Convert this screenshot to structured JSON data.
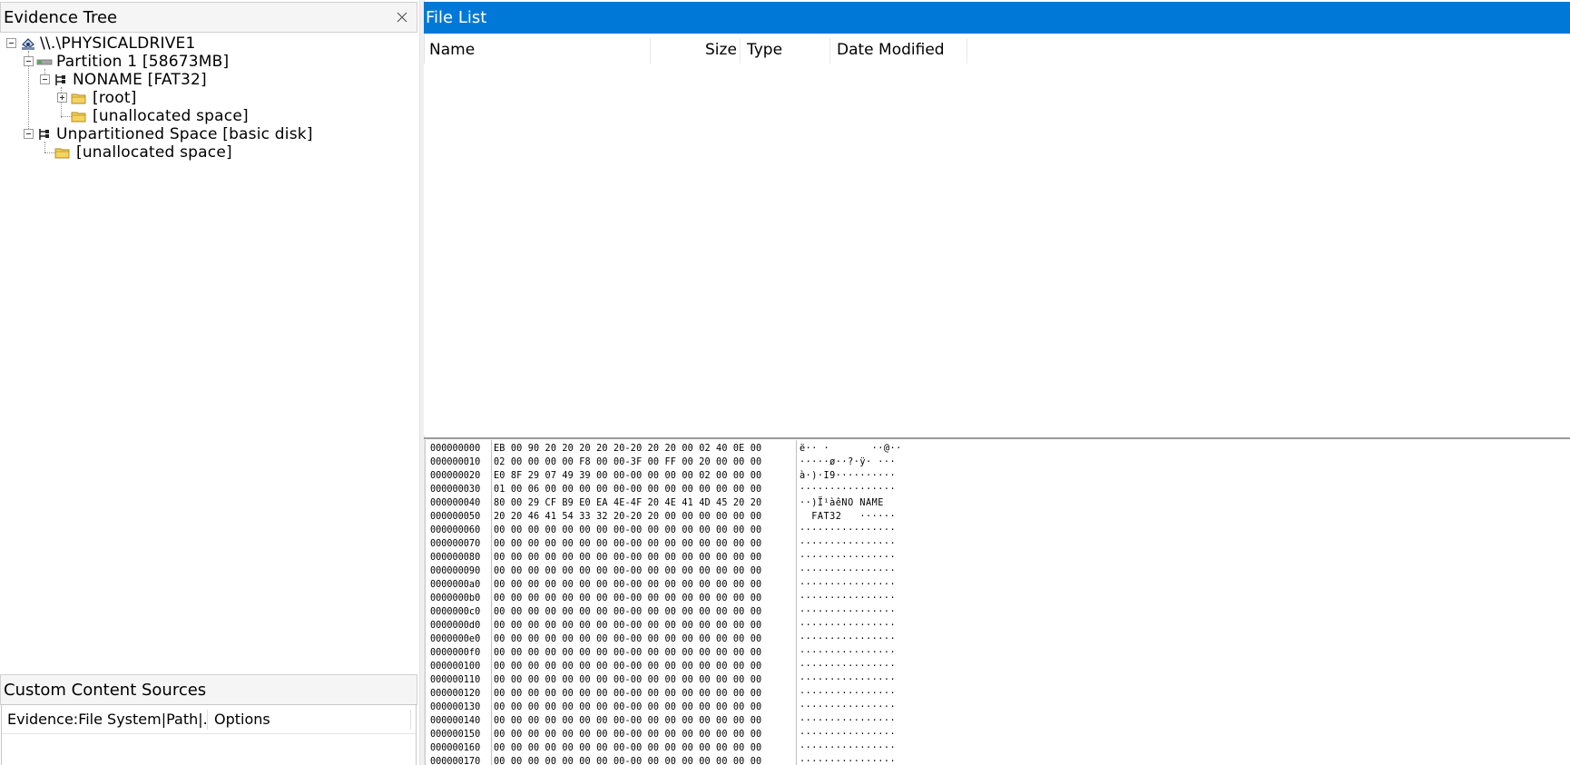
{
  "evidence_tree": {
    "title": "Evidence Tree",
    "nodes": [
      {
        "label": "\\\\.\\PHYSICALDRIVE1",
        "icon": "drive-icon"
      },
      {
        "label": "Partition 1 [58673MB]",
        "icon": "partition-icon"
      },
      {
        "label": "NONAME [FAT32]",
        "icon": "filesystem-icon"
      },
      {
        "label": "[root]",
        "icon": "folder-icon"
      },
      {
        "label": "[unallocated space]",
        "icon": "folder-icon"
      },
      {
        "label": "Unpartitioned Space [basic disk]",
        "icon": "filesystem-icon"
      },
      {
        "label": "[unallocated space]",
        "icon": "folder-icon"
      }
    ]
  },
  "custom_content": {
    "title": "Custom Content Sources",
    "columns": [
      "Evidence:File System|Path|...",
      "Options"
    ]
  },
  "file_list": {
    "title": "File List",
    "columns": [
      "Name",
      "Size",
      "Type",
      "Date Modified"
    ],
    "accent": "#0078d7"
  },
  "hex_view": {
    "rows": [
      {
        "offset": "000000000",
        "bytes": "EB 00 90 20 20 20 20 20-20 20 20 00 02 40 0E 00",
        "ascii": "ë·· ·       ··@··"
      },
      {
        "offset": "000000010",
        "bytes": "02 00 00 00 00 F8 00 00-3F 00 FF 00 20 00 00 00",
        "ascii": "·····ø··?·ÿ· ···"
      },
      {
        "offset": "000000020",
        "bytes": "E0 8F 29 07 49 39 00 00-00 00 00 00 02 00 00 00",
        "ascii": "à·)·I9··········"
      },
      {
        "offset": "000000030",
        "bytes": "01 00 06 00 00 00 00 00-00 00 00 00 00 00 00 00",
        "ascii": "················"
      },
      {
        "offset": "000000040",
        "bytes": "80 00 29 CF B9 E0 EA 4E-4F 20 4E 41 4D 45 20 20",
        "ascii": "··)Ï¹àêNO NAME  "
      },
      {
        "offset": "000000050",
        "bytes": "20 20 46 41 54 33 32 20-20 20 00 00 00 00 00 00",
        "ascii": "  FAT32   ······"
      },
      {
        "offset": "000000060",
        "bytes": "00 00 00 00 00 00 00 00-00 00 00 00 00 00 00 00",
        "ascii": "················"
      },
      {
        "offset": "000000070",
        "bytes": "00 00 00 00 00 00 00 00-00 00 00 00 00 00 00 00",
        "ascii": "················"
      },
      {
        "offset": "000000080",
        "bytes": "00 00 00 00 00 00 00 00-00 00 00 00 00 00 00 00",
        "ascii": "················"
      },
      {
        "offset": "000000090",
        "bytes": "00 00 00 00 00 00 00 00-00 00 00 00 00 00 00 00",
        "ascii": "················"
      },
      {
        "offset": "0000000a0",
        "bytes": "00 00 00 00 00 00 00 00-00 00 00 00 00 00 00 00",
        "ascii": "················"
      },
      {
        "offset": "0000000b0",
        "bytes": "00 00 00 00 00 00 00 00-00 00 00 00 00 00 00 00",
        "ascii": "················"
      },
      {
        "offset": "0000000c0",
        "bytes": "00 00 00 00 00 00 00 00-00 00 00 00 00 00 00 00",
        "ascii": "················"
      },
      {
        "offset": "0000000d0",
        "bytes": "00 00 00 00 00 00 00 00-00 00 00 00 00 00 00 00",
        "ascii": "················"
      },
      {
        "offset": "0000000e0",
        "bytes": "00 00 00 00 00 00 00 00-00 00 00 00 00 00 00 00",
        "ascii": "················"
      },
      {
        "offset": "0000000f0",
        "bytes": "00 00 00 00 00 00 00 00-00 00 00 00 00 00 00 00",
        "ascii": "················"
      },
      {
        "offset": "000000100",
        "bytes": "00 00 00 00 00 00 00 00-00 00 00 00 00 00 00 00",
        "ascii": "················"
      },
      {
        "offset": "000000110",
        "bytes": "00 00 00 00 00 00 00 00-00 00 00 00 00 00 00 00",
        "ascii": "················"
      },
      {
        "offset": "000000120",
        "bytes": "00 00 00 00 00 00 00 00-00 00 00 00 00 00 00 00",
        "ascii": "················"
      },
      {
        "offset": "000000130",
        "bytes": "00 00 00 00 00 00 00 00-00 00 00 00 00 00 00 00",
        "ascii": "················"
      },
      {
        "offset": "000000140",
        "bytes": "00 00 00 00 00 00 00 00-00 00 00 00 00 00 00 00",
        "ascii": "················"
      },
      {
        "offset": "000000150",
        "bytes": "00 00 00 00 00 00 00 00-00 00 00 00 00 00 00 00",
        "ascii": "················"
      },
      {
        "offset": "000000160",
        "bytes": "00 00 00 00 00 00 00 00-00 00 00 00 00 00 00 00",
        "ascii": "················"
      },
      {
        "offset": "000000170",
        "bytes": "00 00 00 00 00 00 00 00-00 00 00 00 00 00 00 00",
        "ascii": "················"
      }
    ]
  }
}
